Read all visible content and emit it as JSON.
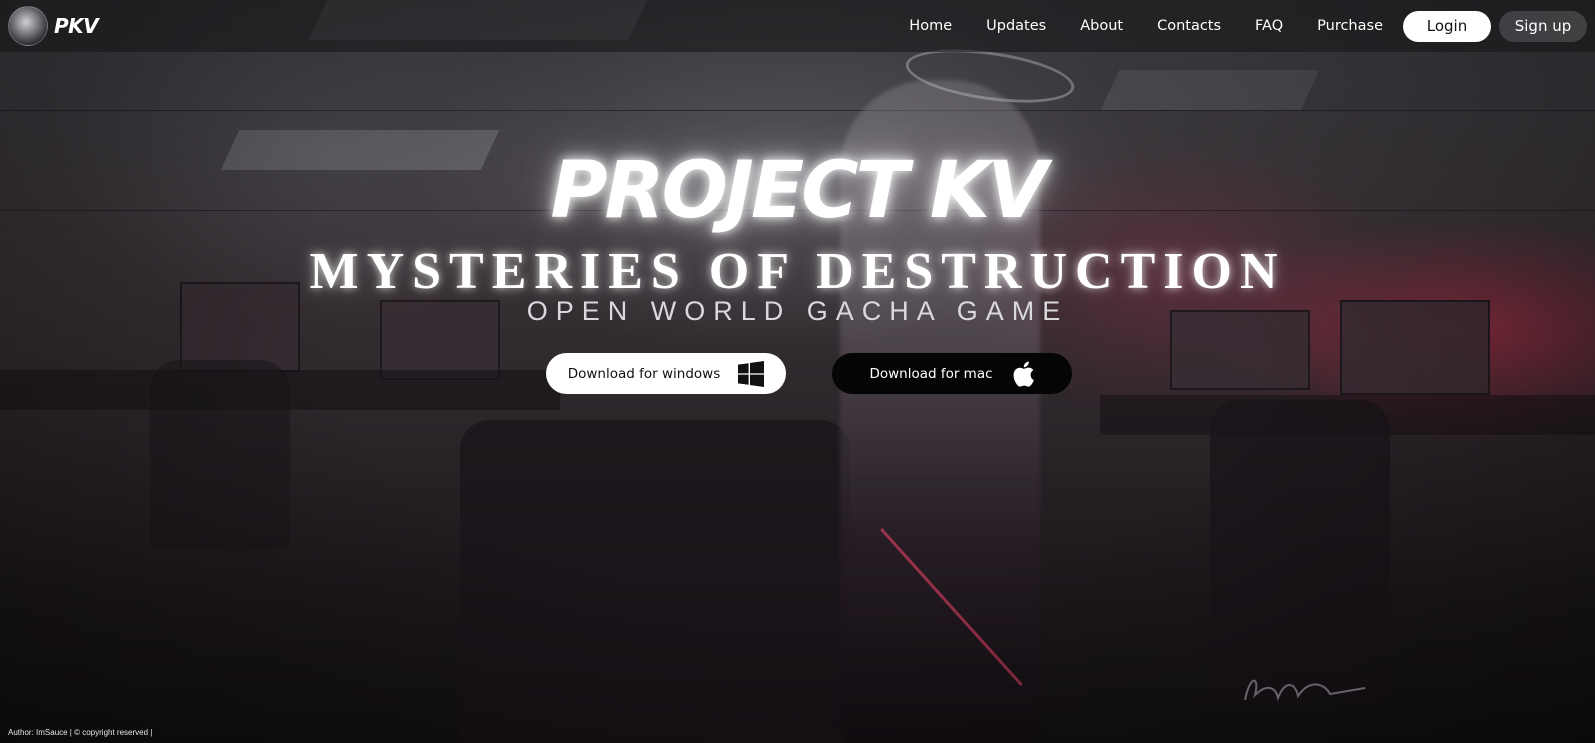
{
  "brand": {
    "logo_text": "PKV"
  },
  "nav": {
    "links": [
      "Home",
      "Updates",
      "About",
      "Contacts",
      "FAQ",
      "Purchase"
    ],
    "login_label": "Login",
    "signup_label": "Sign up"
  },
  "hero": {
    "title": "PROJECT KV",
    "subtitle": "MYSTERIES OF DESTRUCTION",
    "tagline": "OPEN WORLD GACHA GAME"
  },
  "downloads": {
    "windows_label": "Download for windows",
    "windows_icon": "windows-icon",
    "mac_label": "Download for mac",
    "mac_icon": "apple-icon"
  },
  "footer": {
    "credit": "Author: ImSauce | © copyright reserved |"
  },
  "colors": {
    "accent_red": "#c82846",
    "button_light": "#ffffff",
    "button_dark": "#050505"
  }
}
